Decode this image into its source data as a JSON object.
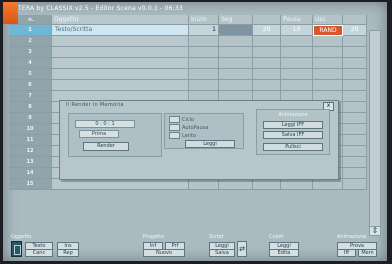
{
  "window": {
    "title": "TERA by CLASSIX v2.5 - Editor Scena v0.0.1 - 06:33"
  },
  "table": {
    "headers": [
      "n.",
      "Oggetto",
      "Inizio",
      "Seg",
      "",
      "Pausa",
      "Usc",
      ""
    ],
    "selected_row": {
      "num": "1",
      "object": "Testo/Scritta",
      "inizio": "1",
      "seg2": "20",
      "pausa": "10",
      "usc": "RAND",
      "usc2": "20"
    },
    "rows": [
      "2",
      "3",
      "4",
      "5",
      "6",
      "7",
      "8",
      "9",
      "10",
      "11",
      "12",
      "13",
      "14",
      "15"
    ]
  },
  "dialog": {
    "title": "Il Render in Memoria",
    "close": "x",
    "left": {
      "field1": "0 : 0 : 1",
      "field2": "Prima",
      "button": "Render"
    },
    "options": [
      "Ciclo",
      "AutoPausa",
      "Lento"
    ],
    "leggi": "Leggi",
    "animazione": {
      "title": "Animazione",
      "buttons": [
        "Leggi IFF",
        "Salva IFF",
        "Pulisci"
      ]
    }
  },
  "toolbar": {
    "oggetto": {
      "label": "Oggetto",
      "b1": "Testo",
      "b2": "Ins",
      "b3": "Canc",
      "b4": "Rep"
    },
    "progetto": {
      "label": "Progetto",
      "b1": "Inf",
      "b2": "Prf",
      "b3": "Nuovo"
    },
    "script": {
      "label": "Script",
      "b1": "Leggi",
      "b2": "Salva",
      "arrow": "⇄"
    },
    "colori": {
      "label": "Colori",
      "b1": "Leggi",
      "b2": "Edita"
    },
    "animazione": {
      "label": "Animazione",
      "b1": "Prova",
      "b2": "Iff",
      "b3": "Mem"
    }
  },
  "scroll": {
    "arrow": "⇕"
  }
}
